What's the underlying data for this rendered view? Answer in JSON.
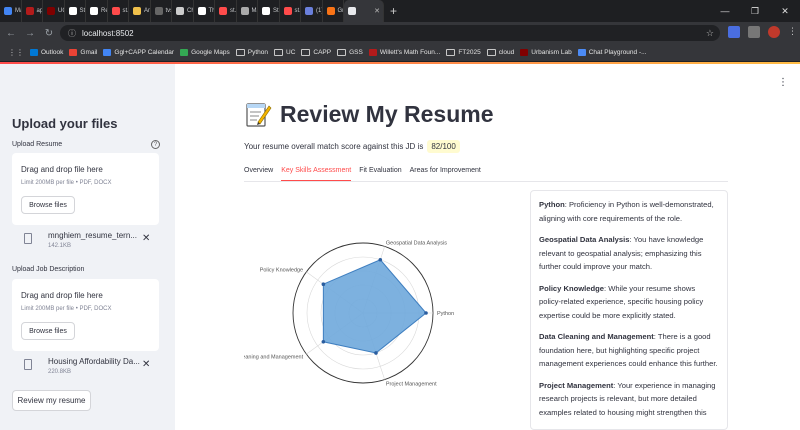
{
  "browser": {
    "tabs": [
      {
        "label": "Mail",
        "color": "#4285f4"
      },
      {
        "label": "apps",
        "color": "#b31b1b"
      },
      {
        "label": "UCh",
        "color": "#800000"
      },
      {
        "label": "Strea",
        "color": "#ffffff"
      },
      {
        "label": "Resu",
        "color": "#ffffff"
      },
      {
        "label": "st.sp",
        "color": "#ff4b4b"
      },
      {
        "label": "Anno",
        "color": "#f0c04b"
      },
      {
        "label": "tvst/",
        "color": "#666666"
      },
      {
        "label": "Chat",
        "color": "#cccccc"
      },
      {
        "label": "The",
        "color": "#ffffff"
      },
      {
        "label": "st.m",
        "color": "#ff4b4b"
      },
      {
        "label": "Maps",
        "color": "#aaaaaa"
      },
      {
        "label": "Strea",
        "color": "#ffffff"
      },
      {
        "label": "st.sp",
        "color": "#ff4b4b"
      },
      {
        "label": "(1) Tr",
        "color": "#6a7fdb"
      },
      {
        "label": "Gradi",
        "color": "#f97316"
      }
    ],
    "url": "localhost:8502",
    "bookmarks": [
      {
        "label": "Outlook",
        "kind": "icon",
        "color": "#0078d4"
      },
      {
        "label": "Gmail",
        "kind": "icon",
        "color": "#ea4335"
      },
      {
        "label": "Ggl+CAPP Calendar",
        "kind": "icon",
        "color": "#4285f4"
      },
      {
        "label": "Google Maps",
        "kind": "icon",
        "color": "#34a853"
      },
      {
        "label": "Python",
        "kind": "folder"
      },
      {
        "label": "UC",
        "kind": "folder"
      },
      {
        "label": "CAPP",
        "kind": "folder"
      },
      {
        "label": "GSS",
        "kind": "folder"
      },
      {
        "label": "Willett's Math Foun...",
        "kind": "icon",
        "color": "#b31b1b"
      },
      {
        "label": "FT2025",
        "kind": "folder"
      },
      {
        "label": "cloud",
        "kind": "folder"
      },
      {
        "label": "Urbanism Lab",
        "kind": "icon",
        "color": "#800000"
      },
      {
        "label": "Chat Playground -...",
        "kind": "icon",
        "color": "#4c8bf5"
      }
    ]
  },
  "sidebar": {
    "title": "Upload your files",
    "resume_label": "Upload Resume",
    "jd_label": "Upload Job Description",
    "dropzone_title": "Drag and drop file here",
    "dropzone_sub": "Limit 200MB per file • PDF, DOCX",
    "browse_label": "Browse files",
    "resume_file": {
      "name": "mnghiem_resume_tern...",
      "size": "142.1KB"
    },
    "jd_file": {
      "name": "Housing Affordability Da...",
      "size": "220.8KB"
    },
    "review_button": "Review my resume"
  },
  "main": {
    "title": "Review My Resume",
    "score_text": "Your resume overall match score against this JD is",
    "score": "82/100",
    "tabs": [
      "Overview",
      "Key Skills Assessment",
      "Fit Evaluation",
      "Areas for Improvement"
    ],
    "active_tab": 1,
    "feedback": [
      {
        "skill": "Python",
        "text": ": Proficiency in Python is well-demonstrated, aligning with core requirements of the role."
      },
      {
        "skill": "Geospatial Data Analysis",
        "text": ": You have knowledge relevant to geospatial analysis; emphasizing this further could improve your match."
      },
      {
        "skill": "Policy Knowledge",
        "text": ": While your resume shows policy-related experience, specific housing policy expertise could be more explicitly stated."
      },
      {
        "skill": "Data Cleaning and Management",
        "text": ": There is a good foundation here, but highlighting specific project management experiences could enhance this further."
      },
      {
        "skill": "Project Management",
        "text": ": Your experience in managing research projects is relevant, but more detailed examples related to housing might strengthen this"
      }
    ]
  },
  "chart_data": {
    "type": "radar",
    "axes": [
      "Python",
      "Geospatial Data Analysis",
      "Policy Knowledge",
      "Data Cleaning and Management",
      "Project Management"
    ],
    "values": [
      9,
      8,
      7,
      7,
      6
    ],
    "range": [
      0,
      10
    ],
    "fill_color": "#6fa8dc",
    "line_color": "#3f7fc0",
    "grid": true
  }
}
